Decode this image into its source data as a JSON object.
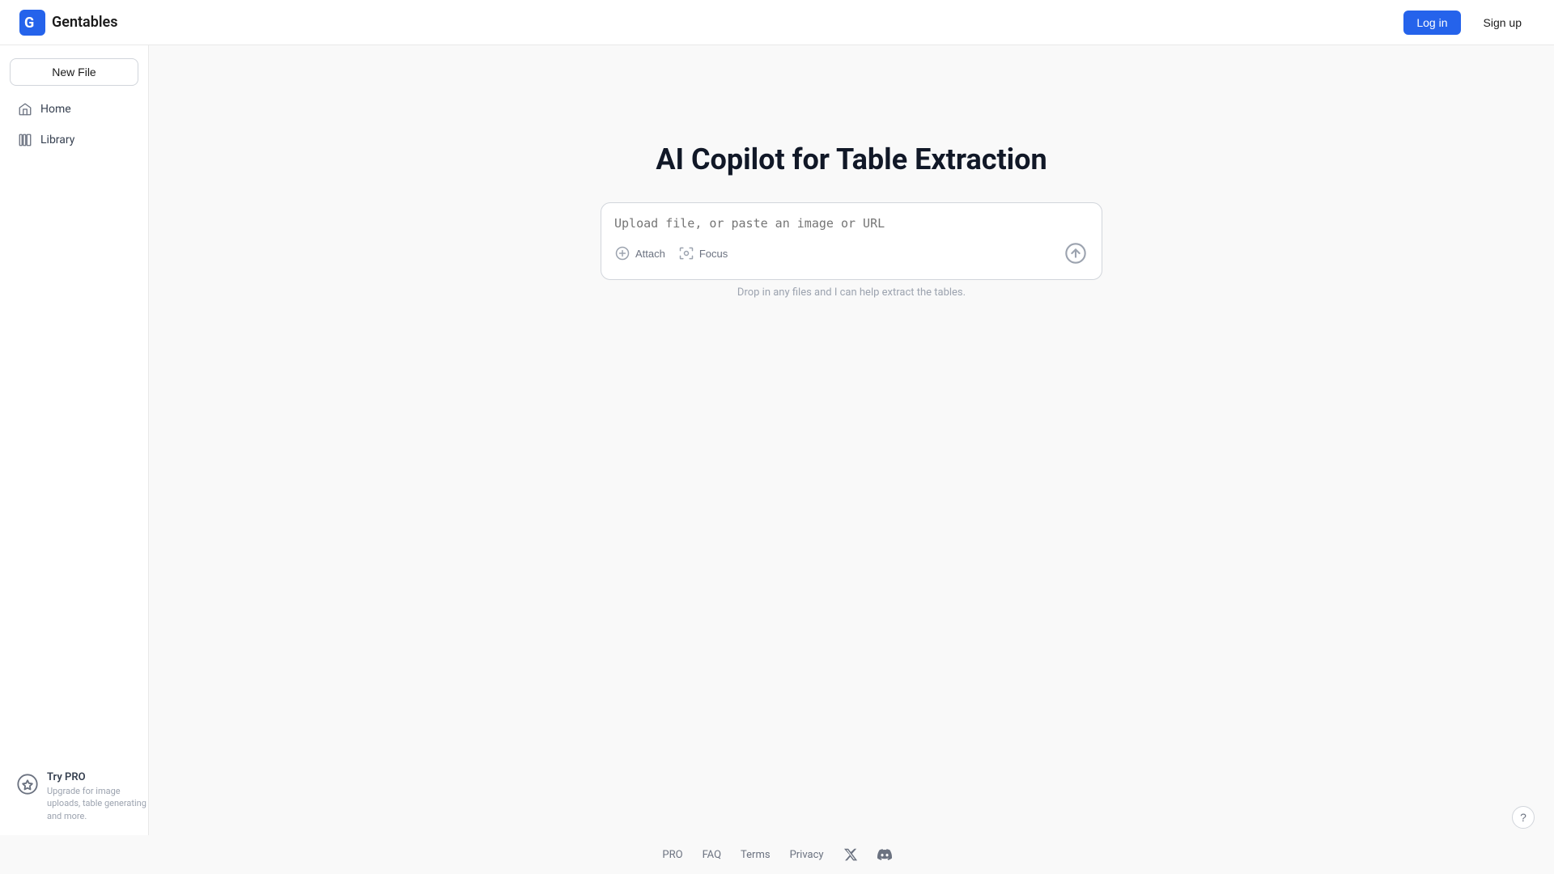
{
  "header": {
    "logo_text": "Gentables",
    "login_label": "Log in",
    "signup_label": "Sign up"
  },
  "sidebar": {
    "new_file_label": "New File",
    "items": [
      {
        "id": "home",
        "label": "Home"
      },
      {
        "id": "library",
        "label": "Library"
      }
    ]
  },
  "main": {
    "title": "AI Copilot for Table Extraction",
    "input_placeholder": "Upload file, or paste an image or URL",
    "attach_label": "Attach",
    "focus_label": "Focus",
    "drop_hint": "Drop in any files and I can help extract the tables."
  },
  "try_pro": {
    "title": "Try PRO",
    "description": "Upgrade for image uploads, table generating and more."
  },
  "footer": {
    "links": [
      {
        "id": "pro",
        "label": "PRO"
      },
      {
        "id": "faq",
        "label": "FAQ"
      },
      {
        "id": "terms",
        "label": "Terms"
      },
      {
        "id": "privacy",
        "label": "Privacy"
      }
    ]
  }
}
